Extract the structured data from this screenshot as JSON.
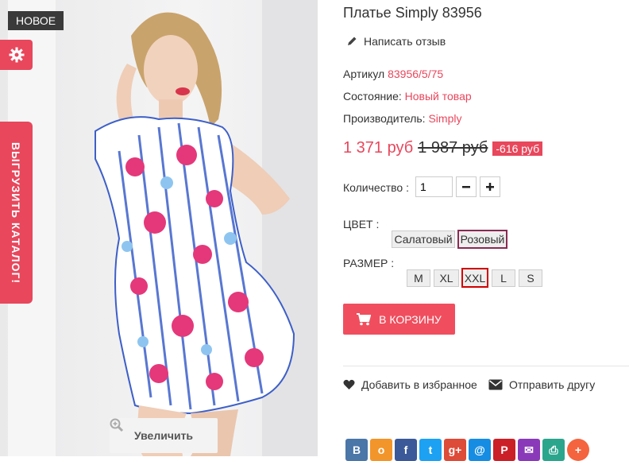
{
  "photo": {
    "badge": "НОВОЕ",
    "zoom_label": "Увеличить"
  },
  "side": {
    "catalog_label": "ВЫГРУЗИТЬ КАТАЛОГ!"
  },
  "product": {
    "title": "Платье Simply 83956",
    "review_label": "Написать отзыв",
    "article_label": "Артикул",
    "article_value": "83956/5/75",
    "condition_label": "Состояние:",
    "condition_value": "Новый товар",
    "maker_label": "Производитель:",
    "maker_value": "Simply",
    "price_new": "1 371 руб",
    "price_old": "1 987 руб",
    "discount": "-616 руб",
    "qty_label": "Количество :",
    "qty_value": "1",
    "color_label": "ЦВЕТ :",
    "colors": [
      "Салатовый",
      "Розовый"
    ],
    "size_label": "РАЗМЕР :",
    "sizes": [
      "M",
      "XL",
      "XXL",
      "L",
      "S"
    ],
    "cart_label": "В КОРЗИНУ"
  },
  "actions": {
    "wishlist_label": "Добавить в избранное",
    "send_label": "Отправить другу"
  },
  "social": [
    {
      "icon": "vk-icon",
      "glyph": "В",
      "color": "#4a76a8"
    },
    {
      "icon": "odnoklassniki-icon",
      "glyph": "о",
      "color": "#f2952a"
    },
    {
      "icon": "facebook-icon",
      "glyph": "f",
      "color": "#3b5998"
    },
    {
      "icon": "twitter-icon",
      "glyph": "t",
      "color": "#1da1f2"
    },
    {
      "icon": "googleplus-icon",
      "glyph": "g+",
      "color": "#dd4b39"
    },
    {
      "icon": "mailru-icon",
      "glyph": "@",
      "color": "#168de2"
    },
    {
      "icon": "pinterest-icon",
      "glyph": "P",
      "color": "#cb2027"
    },
    {
      "icon": "email-icon",
      "glyph": "✉",
      "color": "#8a3ab9"
    },
    {
      "icon": "print-icon",
      "glyph": "⎙",
      "color": "#2ca58d"
    },
    {
      "icon": "more-icon",
      "glyph": "+",
      "color": "#f4643e"
    }
  ]
}
